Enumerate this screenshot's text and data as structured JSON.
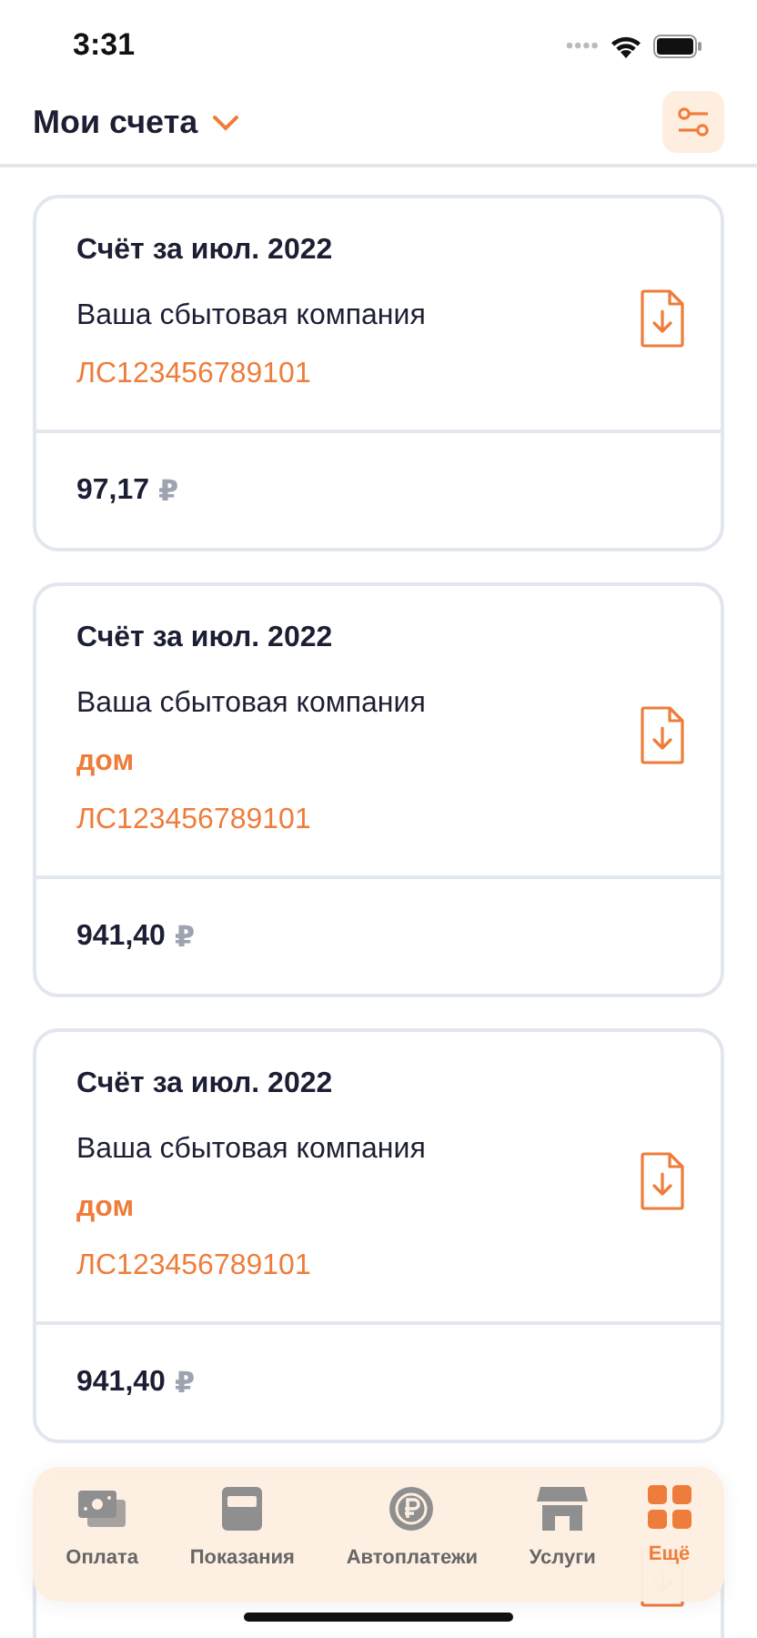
{
  "status_bar": {
    "time": "3:31"
  },
  "header": {
    "title": "Мои счета"
  },
  "cards": [
    {
      "kind": "bill",
      "title": "Счёт за июл. 2022",
      "company": "Ваша сбытовая компания",
      "account": "ЛС123456789101",
      "amount": "97,17",
      "currency": "₽"
    },
    {
      "kind": "bill",
      "title": "Счёт за июл. 2022",
      "company": "Ваша сбытовая компания",
      "tag": "дом",
      "account": "ЛС123456789101",
      "amount": "941,40",
      "currency": "₽"
    },
    {
      "kind": "bill",
      "title": "Счёт за июл. 2022",
      "company": "Ваша сбытовая компания",
      "tag": "дом",
      "account": "ЛС123456789101",
      "amount": "941,40",
      "currency": "₽"
    },
    {
      "kind": "covered"
    }
  ],
  "tab_bar": [
    {
      "kind": "cash",
      "label": "Оплата",
      "selected": false
    },
    {
      "kind": "meter",
      "label": "Показания",
      "selected": false
    },
    {
      "kind": "autopay",
      "label": "Автоплатежи",
      "selected": false
    },
    {
      "kind": "store",
      "label": "Услуги",
      "selected": false
    },
    {
      "kind": "grid",
      "label": "Ещё",
      "selected": true
    }
  ]
}
